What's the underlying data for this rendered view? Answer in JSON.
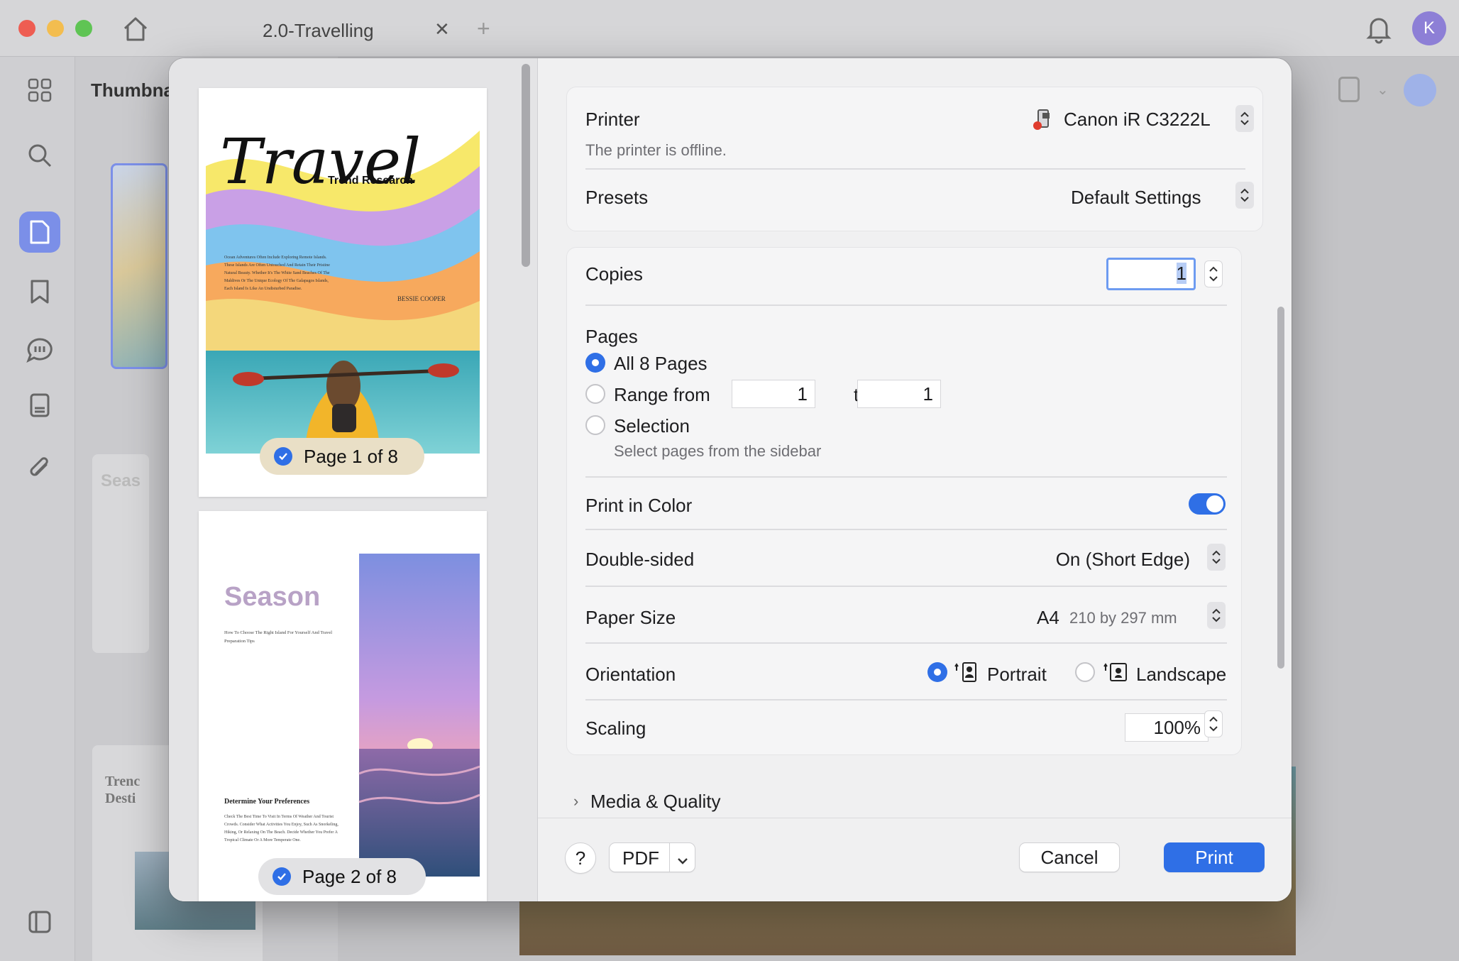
{
  "window": {
    "tab_title": "2.0-Travelling",
    "avatar_letter": "K"
  },
  "sidebar": {
    "thumbnails_title": "Thumbna"
  },
  "background_thumbs": {
    "t2": "Seas",
    "t3a": "Trenc",
    "t3b": "Desti"
  },
  "preview": {
    "page1": {
      "badge": "Page 1 of 8",
      "title": "Travel",
      "subtitle": "Trend Research",
      "author": "BESSIE COOPER",
      "body": "Ocean Adventures Often Include Exploring Remote Islands. These Islands Are Often Untouched And Retain Their Pristine Natural Beauty. Whether It's The White Sand Beaches Of The Maldives Or The Unique Ecology Of The Galapagos Islands, Each Island Is Like An Undisturbed Paradise."
    },
    "page2": {
      "badge": "Page 2 of 8",
      "title": "Season",
      "intro": "How To Choose The Right Island For Yourself And Travel Preparation Tips",
      "heading": "Determine Your Preferences",
      "body": "Check The Best Time To Visit In Terms Of Weather And Tourist Crowds. Consider What Activities You Enjoy, Such As Snorkeling, Hiking, Or Relaxing On The Beach. Decide Whether You Prefer A Tropical Climate Or A More Temperate One."
    }
  },
  "printer": {
    "label": "Printer",
    "name": "Canon iR C3222L",
    "status": "The printer is offline.",
    "presets_label": "Presets",
    "presets_value": "Default Settings"
  },
  "copies": {
    "label": "Copies",
    "value": "1"
  },
  "pages": {
    "label": "Pages",
    "all": "All 8 Pages",
    "range_label": "Range from",
    "range_from": "1",
    "range_to_label": "to",
    "range_to": "1",
    "selection": "Selection",
    "selection_hint": "Select pages from the sidebar",
    "selected": "all"
  },
  "color": {
    "label": "Print in Color",
    "enabled": true
  },
  "double_sided": {
    "label": "Double-sided",
    "value": "On (Short Edge)"
  },
  "paper": {
    "label": "Paper Size",
    "value": "A4",
    "detail": "210 by 297 mm"
  },
  "orientation": {
    "label": "Orientation",
    "portrait": "Portrait",
    "landscape": "Landscape",
    "selected": "portrait"
  },
  "scaling": {
    "label": "Scaling",
    "value": "100%"
  },
  "media": {
    "label": "Media & Quality"
  },
  "footer": {
    "help": "?",
    "pdf": "PDF",
    "cancel": "Cancel",
    "print": "Print"
  },
  "colors": {
    "accent": "#2f6fe6"
  }
}
